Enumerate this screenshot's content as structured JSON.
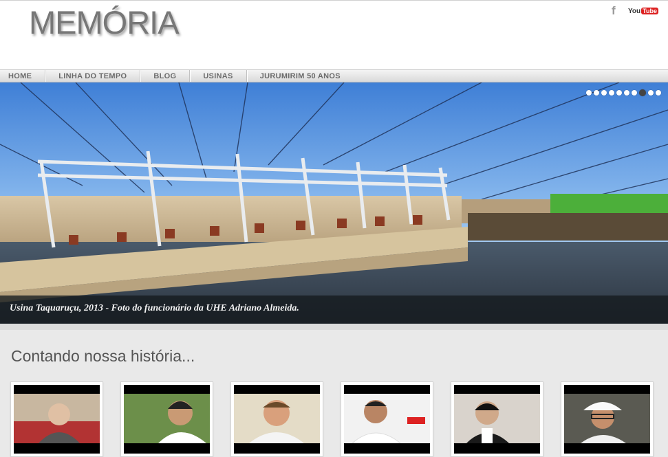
{
  "site": {
    "logo": "MEMÓRIA"
  },
  "social": {
    "facebook": "f",
    "youtube_you": "You",
    "youtube_tube": "Tube"
  },
  "nav": [
    {
      "label": "HOME"
    },
    {
      "label": "LINHA DO TEMPO"
    },
    {
      "label": "BLOG"
    },
    {
      "label": "USINAS"
    },
    {
      "label": "JURUMIRIM 50 ANOS"
    }
  ],
  "slider": {
    "caption": "Usina Taquaruçu, 2013 - Foto do funcionário da UHE Adriano Almeida.",
    "dots_total": 10,
    "active_dot": 8
  },
  "section": {
    "title": "Contando nossa história..."
  },
  "videos": [
    {
      "id": "video-1",
      "person": "elderly-man"
    },
    {
      "id": "video-2",
      "person": "man-dark-hair"
    },
    {
      "id": "video-3",
      "person": "man-bearded"
    },
    {
      "id": "video-4",
      "person": "man-white-shirt"
    },
    {
      "id": "video-5",
      "person": "man-asian"
    },
    {
      "id": "video-6",
      "person": "man-hardhat"
    }
  ],
  "colors": {
    "nav_text": "#6a6a6a",
    "caption_bg": "#14191e",
    "accent_grass": "#4caf3a"
  }
}
